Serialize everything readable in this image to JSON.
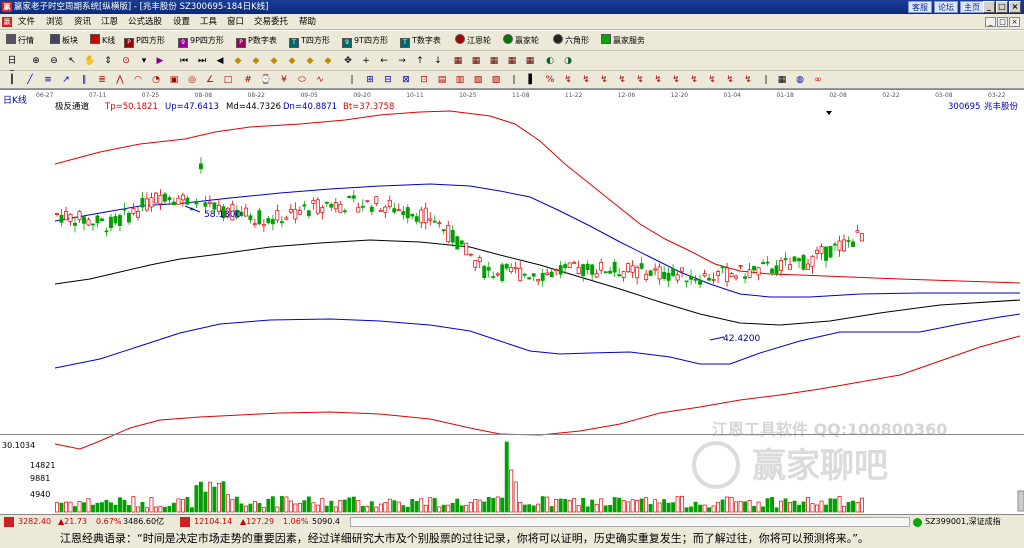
{
  "window": {
    "title": "赢家老子时空周期系统[纵横版] - [兆丰股份  SZ300695-184日K线]",
    "links": [
      "客服",
      "论坛",
      "主页"
    ]
  },
  "menu": [
    "文件",
    "浏览",
    "资讯",
    "江恩",
    "公式选股",
    "设置",
    "工具",
    "窗口",
    "交易委托",
    "帮助"
  ],
  "toolbar": [
    {
      "label": "行情",
      "icon": "grid-icon"
    },
    {
      "label": "板块",
      "icon": "blocks-icon"
    },
    {
      "label": "K线",
      "icon": "candle-icon"
    },
    {
      "label": "P四方形",
      "icon": "square-p-icon"
    },
    {
      "label": "9P四方形",
      "icon": "square-9p-icon"
    },
    {
      "label": "P数字表",
      "icon": "table-p-icon"
    },
    {
      "label": "T四方形",
      "icon": "square-t-icon"
    },
    {
      "label": "9T四方形",
      "icon": "square-9t-icon"
    },
    {
      "label": "T数字表",
      "icon": "table-t-icon"
    },
    {
      "label": "江恩轮",
      "icon": "wheel-icon"
    },
    {
      "label": "赢家轮",
      "icon": "wheel2-icon"
    },
    {
      "label": "六角形",
      "icon": "hexagon-icon"
    },
    {
      "label": "赢家服务",
      "icon": "service-icon"
    }
  ],
  "chart": {
    "period_label": "日K线",
    "indicator_name": "极反通道",
    "tp": "Tp=50.1821",
    "up": "Up=47.6413",
    "md": "Md=44.7326",
    "dn": "Dn=40.8871",
    "bt": "Bt=37.3758",
    "stock_code": "300695",
    "stock_name": "兆丰股份",
    "date_ticks": [
      "06-27",
      "07-11",
      "07-25",
      "08-08",
      "08-22",
      "09-05",
      "09-20",
      "10-11",
      "10-25",
      "11-08",
      "11-22",
      "12-06",
      "12-20",
      "01-04",
      "01-18",
      "02-08",
      "02-22",
      "03-08",
      "03-22"
    ],
    "high_label": "58.1800",
    "low_label": "42.4200",
    "volume_ticks": [
      "30.1034",
      "14821",
      "9881",
      "4940"
    ],
    "watermark_line1": "江恩工具软件  QQ:100800360",
    "watermark_line2": "赢家聊吧"
  },
  "status": {
    "index1": "3282.40",
    "index1_change": "▲21.73",
    "index1_pct": "0.67%",
    "index1_amount": "3486.60亿",
    "index2": "12104.14",
    "index2_change": "▲127.29",
    "index2_pct": "1.06%",
    "index2_amount": "5090.4",
    "index3": "SZ399001,深证成指"
  },
  "quote": "江恩经典语录：“时间是决定市场走势的重要因素，经过详细研究大市及个别股票的过往记录，你将可以证明，历史确实重复发生；而了解过往，你将可以预测将来。”。",
  "colors": {
    "up": "#e00000",
    "down": "#00a000",
    "upper_band": "#e00000",
    "mid_band": "#0000cc",
    "middle": "#000000"
  },
  "chart_data": {
    "type": "candlestick",
    "title": "兆丰股份 300695 日K线",
    "x": [
      "06-27",
      "07-11",
      "07-25",
      "08-08",
      "08-22",
      "09-05",
      "09-20",
      "10-11",
      "10-25",
      "11-08",
      "11-22",
      "12-06",
      "12-20",
      "01-04",
      "01-18",
      "02-08"
    ],
    "close": [
      48.5,
      47.5,
      50.5,
      49.0,
      48.0,
      49.5,
      49.5,
      48.2,
      43.0,
      42.8,
      43.3,
      43.0,
      42.5,
      43.0,
      44.0,
      46.5
    ],
    "series": [
      {
        "name": "Tp",
        "value": 50.1821
      },
      {
        "name": "Up",
        "value": 47.6413
      },
      {
        "name": "Md",
        "value": 44.7326
      },
      {
        "name": "Dn",
        "value": 40.8871
      },
      {
        "name": "Bt",
        "value": 37.3758
      }
    ],
    "annotations": [
      {
        "label": "58.1800",
        "type": "high"
      },
      {
        "label": "42.4200",
        "type": "low"
      }
    ]
  }
}
